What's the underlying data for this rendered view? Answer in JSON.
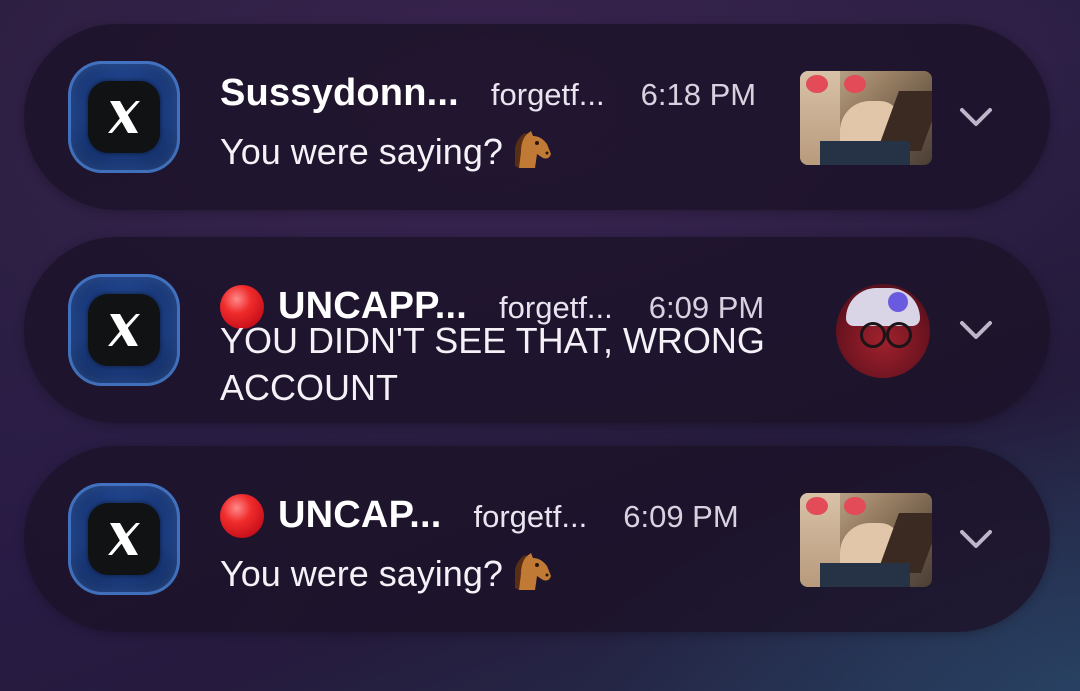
{
  "notifications": [
    {
      "app_icon": "x-app-icon",
      "live_indicator": false,
      "sender": "Sussydonn...",
      "account": "forgetf...",
      "time": "6:18 PM",
      "message": "You were saying?",
      "emoji": "horse-face-emoji",
      "media": "image-thumbnail",
      "expand_icon": "chevron-down-icon"
    },
    {
      "app_icon": "x-app-icon",
      "live_indicator": true,
      "sender": "UNCAPP...",
      "account": "forgetf...",
      "time": "6:09 PM",
      "message": "YOU DIDN'T SEE THAT, WRONG ACCOUNT",
      "media": "avatar",
      "expand_icon": "chevron-down-icon"
    },
    {
      "app_icon": "x-app-icon",
      "live_indicator": true,
      "sender": "UNCAP...",
      "account": "forgetf...",
      "time": "6:09 PM",
      "message": "You were saying?",
      "emoji": "horse-face-emoji",
      "media": "image-thumbnail",
      "expand_icon": "chevron-down-icon"
    }
  ],
  "colors": {
    "live_dot": "#f02c2c",
    "card_background": "#1c1228",
    "app_icon_glow": "#2f5fb0"
  }
}
